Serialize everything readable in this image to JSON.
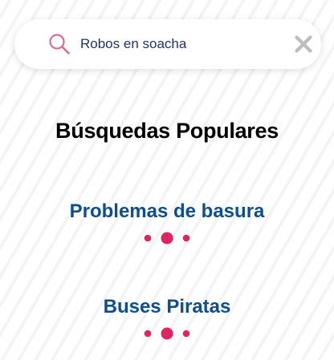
{
  "search": {
    "value": "Robos en soacha",
    "icon": "search-icon",
    "clear_icon": "close-icon"
  },
  "heading": "Búsquedas Populares",
  "popular_searches": [
    {
      "label": "Problemas de basura"
    },
    {
      "label": "Buses Piratas"
    }
  ],
  "colors": {
    "accent": "#e0245e",
    "link": "#0d4f8c",
    "heading": "#000000",
    "search_icon": "#e06a94",
    "clear_icon": "#bdbdbd"
  }
}
